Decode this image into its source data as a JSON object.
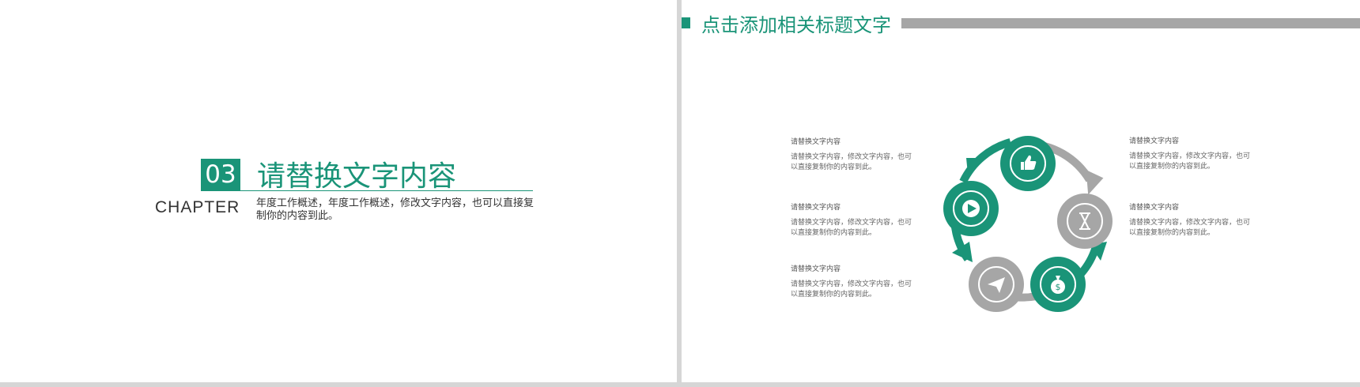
{
  "left": {
    "number": "03",
    "title": "请替换文字内容",
    "chapter": "CHAPTER",
    "description": "年度工作概述，年度工作概述，修改文字内容，也可以直接复制你的内容到此。"
  },
  "right": {
    "header_title": "点击添加相关标题文字",
    "items": [
      {
        "title": "请替换文字内容",
        "desc": "请替换文字内容，修改文字内容，也可以直接复制你的内容到此。"
      },
      {
        "title": "请替换文字内容",
        "desc": "请替换文字内容，修改文字内容，也可以直接复制你的内容到此。"
      },
      {
        "title": "请替换文字内容",
        "desc": "请替换文字内容，修改文字内容，也可以直接复制你的内容到此。"
      },
      {
        "title": "请替换文字内容",
        "desc": "请替换文字内容，修改文字内容，也可以直接复制你的内容到此。"
      },
      {
        "title": "请替换文字内容",
        "desc": "请替换文字内容，修改文字内容，也可以直接复制你的内容到此。"
      }
    ],
    "cycle_icons": [
      "thumbs-up-icon",
      "hourglass-icon",
      "money-bag-icon",
      "paper-plane-icon",
      "play-icon"
    ]
  },
  "colors": {
    "accent": "#1a9478",
    "gray": "#a6a6a6",
    "divider": "#d6d6d6"
  }
}
